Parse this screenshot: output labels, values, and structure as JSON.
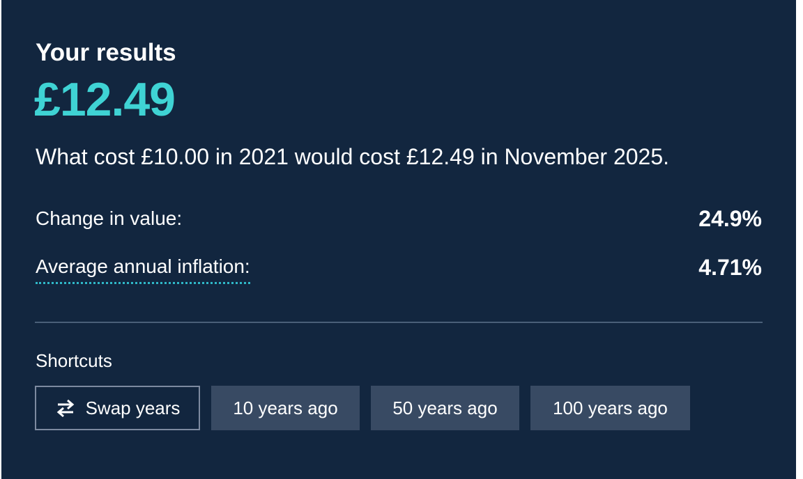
{
  "results": {
    "heading": "Your results",
    "amount": "£12.49",
    "summary": "What cost £10.00 in 2021 would cost £12.49 in November 2025."
  },
  "metrics": [
    {
      "label": "Change in value:",
      "value": "24.9%"
    },
    {
      "label": "Average annual inflation:",
      "value": "4.71%"
    }
  ],
  "shortcuts": {
    "label": "Shortcuts",
    "buttons": [
      {
        "label": "Swap years",
        "icon": "swap-arrows-icon"
      },
      {
        "label": "10 years ago"
      },
      {
        "label": "50 years ago"
      },
      {
        "label": "100 years ago"
      }
    ]
  },
  "colors": {
    "panel_background": "#12263f",
    "accent": "#3fd3d4",
    "button_background": "#384a63",
    "dotted_underline": "#2fb8c8"
  }
}
